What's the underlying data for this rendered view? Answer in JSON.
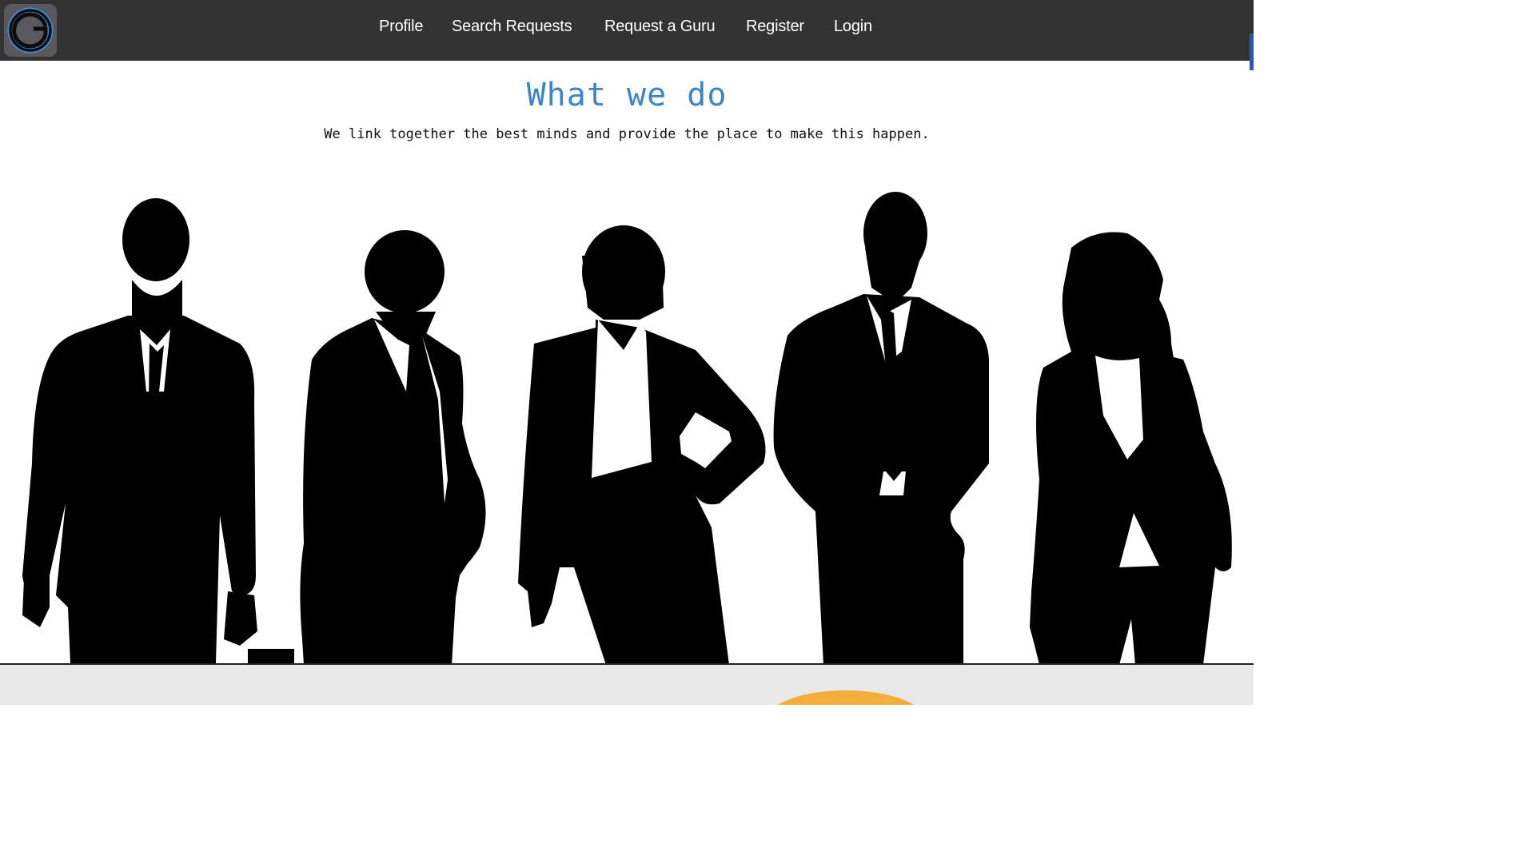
{
  "nav": {
    "logo_icon": "g-logo-icon",
    "links": [
      "Profile",
      "Search Requests",
      "Request a Guru",
      "Register",
      "Login"
    ]
  },
  "hero": {
    "title": "What we do",
    "subtitle": "We link together the best minds and provide the place to make this happen."
  },
  "illustration": {
    "icon": "business-people-silhouettes"
  },
  "colors": {
    "navbar": "#333333",
    "accent_blue": "#3d86c6",
    "footer_band": "#e8e8e8",
    "footer_circle": "#f2ad3b"
  }
}
